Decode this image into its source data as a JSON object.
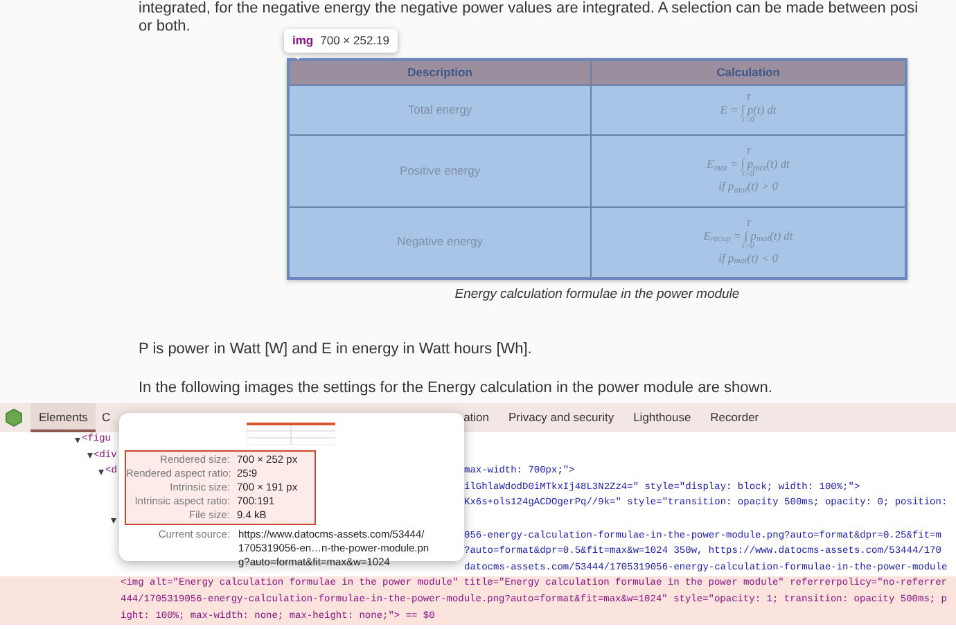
{
  "article": {
    "intro_lines": [
      "integrated, for the negative energy the negative power values are integrated. A selection can be made between posi",
      "or both."
    ],
    "hover_tooltip": {
      "tag": "img",
      "size": "700 × 252.19"
    },
    "figure": {
      "columns": [
        "Description",
        "Calculation"
      ],
      "rows": [
        {
          "description": "Total energy",
          "formula": {
            "upper": "T",
            "main": "E = ∫ p(t) dt",
            "lower": "t=0"
          }
        },
        {
          "description": "Positive energy",
          "formula": {
            "upper": "T",
            "main": "E$_{mot}$ = ∫ p$_{mot}$(t) dt",
            "lower": "t=0",
            "condition": "if p$_{mot}$(t) > 0"
          }
        },
        {
          "description": "Negative energy",
          "formula": {
            "upper": "T",
            "main": "E$_{recup}$ = ∫ p$_{mot}$(t) dt",
            "lower": "t=0",
            "condition": "if p$_{mot}$(t) < 0"
          }
        }
      ],
      "caption": "Energy calculation formulae in the power module"
    },
    "paragraphs": [
      "P is power in Watt [W] and E in energy in Watt hours [Wh].",
      "In the following images the settings for the Energy calculation in the power module are shown."
    ]
  },
  "devtools": {
    "tabs": [
      {
        "label": "Elements",
        "selected": true
      },
      {
        "label": "C",
        "selected": false
      },
      {
        "label": "ation",
        "selected": false
      },
      {
        "label": "Privacy and security",
        "selected": false
      },
      {
        "label": "Lighthouse",
        "selected": false
      },
      {
        "label": "Recorder",
        "selected": false
      }
    ],
    "tree": [
      {
        "tag": "<figu",
        "expanded": true,
        "selected": false,
        "children": [
          {
            "tag": "<div",
            "expanded": true,
            "selected": false,
            "children": [
              {
                "tag": "<d",
                "expanded": true,
                "selected": false,
                "right": "max-width: 700px;\">",
                "children": [
                  {
                    "selected": false,
                    "right": "ilGhlaWdodD0iMTkxIj48L3N2Zz4=\" style=\"display: block; width: 100%;\">"
                  },
                  {
                    "selected": false,
                    "right": "Kx6s+ols124gACDOgerPq//9k=\" style=\"transition: opacity 500ms; opacity: 0; position:"
                  },
                  {
                    "expanded": true,
                    "selected": false,
                    "children": [
                      {
                        "selected": false,
                        "right": "056-energy-calculation-formulae-in-the-power-module.png?auto=format&dpr=0.25&fit=m"
                      },
                      {
                        "selected": false,
                        "right": "?auto=format&dpr=0.5&fit=max&w=1024 350w, https://www.datocms-assets.com/53444/170"
                      },
                      {
                        "selected": false,
                        "right": "datocms-assets.com/53444/1705319056-energy-calculation-formulae-in-the-power-module"
                      },
                      {
                        "selected": true,
                        "lines": [
                          "<img alt=\"Energy calculation formulae in the power module\" title=\"Energy calculation formulae in the power module\" referrerpolicy=\"no-referrer",
                          "444/1705319056-energy-calculation-formulae-in-the-power-module.png?auto=format&fit=max&w=1024\" style=\"opacity: 1; transition: opacity 500ms; p",
                          "ight: 100%; max-width: none; max-height: none;\"> == $0"
                        ]
                      }
                    ]
                  }
                ]
              }
            ]
          }
        ]
      }
    ],
    "image_popover": {
      "details": [
        {
          "label": "Rendered size:",
          "value": "700 × 252 px"
        },
        {
          "label": "Rendered aspect ratio:",
          "value": "25∶9"
        },
        {
          "label": "Intrinsic size:",
          "value": "700 × 191 px"
        },
        {
          "label": "Intrinsic aspect ratio:",
          "value": "700:191"
        },
        {
          "label": "File size:",
          "value": "9.4 kB"
        }
      ],
      "source_label": "Current source:",
      "source_lines": [
        "https://www.datocms-assets.com/53444/",
        "1705319056-en…n-the-power-module.pn",
        "g?auto=format&fit=max&w=1024"
      ]
    }
  }
}
